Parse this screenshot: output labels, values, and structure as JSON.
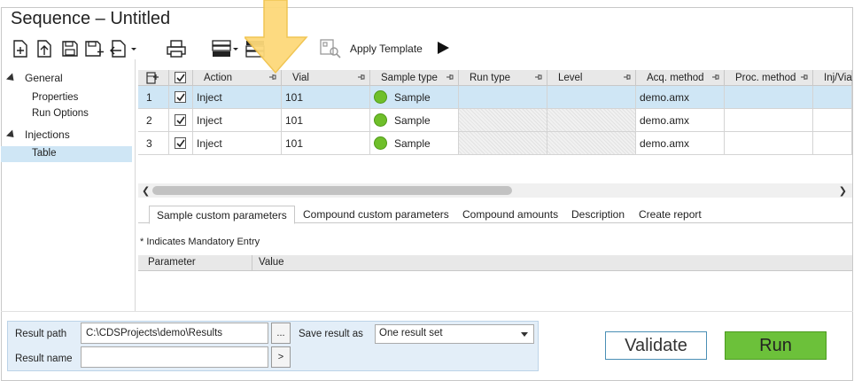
{
  "window": {
    "title": "Sequence – Untitled"
  },
  "toolbar": {
    "apply_template_label": "Apply Template",
    "icons": [
      "new-document-icon",
      "import-icon",
      "save-icon",
      "save-as-icon",
      "export-icon",
      "print-icon",
      "insert-rows-icon",
      "delete-rows-icon",
      "template-icon",
      "run-play-icon"
    ]
  },
  "nav": {
    "groups": [
      {
        "label": "General",
        "items": [
          "Properties",
          "Run Options"
        ]
      },
      {
        "label": "Injections",
        "items": [
          "Table"
        ]
      }
    ],
    "selected": "Table"
  },
  "grid": {
    "columns": [
      "Action",
      "Vial",
      "Sample type",
      "Run type",
      "Level",
      "Acq. method",
      "Proc. method",
      "Inj/Vial"
    ],
    "rows": [
      {
        "num": "1",
        "checked": true,
        "action": "Inject",
        "vial": "101",
        "sample_type": "Sample",
        "run_type": "",
        "level": "",
        "acq_method": "demo.amx",
        "proc_method": "",
        "inj_vial": ""
      },
      {
        "num": "2",
        "checked": true,
        "action": "Inject",
        "vial": "101",
        "sample_type": "Sample",
        "run_type": "",
        "level": "",
        "acq_method": "demo.amx",
        "proc_method": "",
        "inj_vial": ""
      },
      {
        "num": "3",
        "checked": true,
        "action": "Inject",
        "vial": "101",
        "sample_type": "Sample",
        "run_type": "",
        "level": "",
        "acq_method": "demo.amx",
        "proc_method": "",
        "inj_vial": ""
      }
    ],
    "selected_row": "1"
  },
  "tabs": {
    "items": [
      "Sample custom parameters",
      "Compound custom parameters",
      "Compound amounts",
      "Description",
      "Create report"
    ],
    "active": "Sample custom parameters"
  },
  "params": {
    "mandatory_note": "* Indicates Mandatory Entry",
    "header_parameter": "Parameter",
    "header_value": "Value"
  },
  "result": {
    "path_label": "Result path",
    "path_value": "C:\\CDSProjects\\demo\\Results",
    "browse_label": "...",
    "name_label": "Result name",
    "name_value": "",
    "name_button": ">",
    "save_as_label": "Save result as",
    "save_as_value": "One result set"
  },
  "actions": {
    "validate": "Validate",
    "run": "Run"
  },
  "colors": {
    "selection": "#cfe6f5",
    "run_green": "#6cc13a",
    "sample_dot": "#6fbf2a",
    "callout": "#fdd97a"
  }
}
